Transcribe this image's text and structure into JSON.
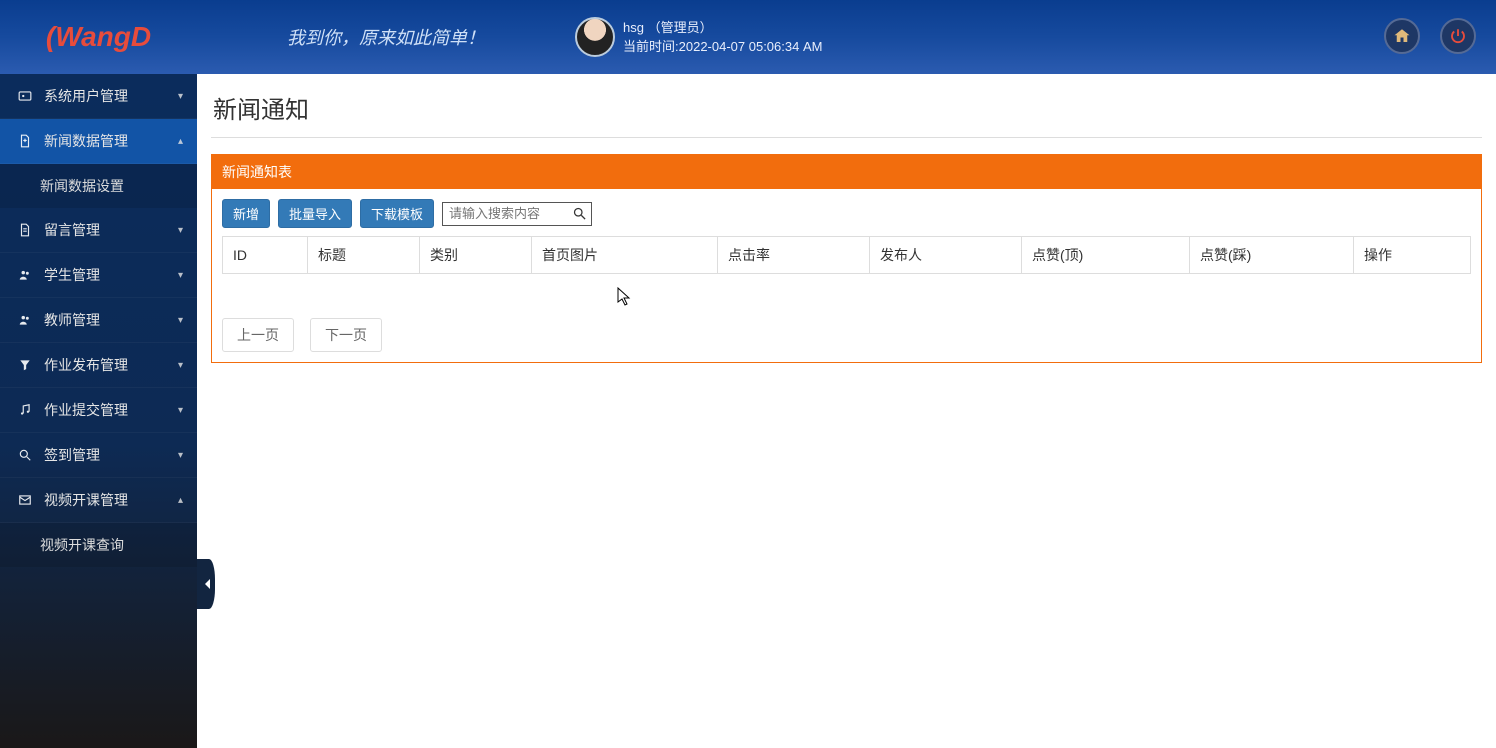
{
  "header": {
    "logo_red_arc": "(",
    "logo_text_1": "Wang",
    "logo_text_2": "D",
    "tagline": "我到你，原来如此简单！",
    "user_name": "hsg",
    "user_role": "（管理员）",
    "time_prefix": "当前时间:",
    "time_value": "2022-04-07 05:06:34 AM"
  },
  "sidebar": {
    "items": [
      {
        "label": "系统用户管理",
        "icon": "id-card-icon",
        "caret": "▾",
        "active": false
      },
      {
        "label": "新闻数据管理",
        "icon": "file-icon",
        "caret": "▴",
        "active": true,
        "children": [
          {
            "label": "新闻数据设置"
          }
        ]
      },
      {
        "label": "留言管理",
        "icon": "doc-icon",
        "caret": "▾",
        "active": false
      },
      {
        "label": "学生管理",
        "icon": "users-icon",
        "caret": "▾",
        "active": false
      },
      {
        "label": "教师管理",
        "icon": "users-icon",
        "caret": "▾",
        "active": false
      },
      {
        "label": "作业发布管理",
        "icon": "filter-icon",
        "caret": "▾",
        "active": false
      },
      {
        "label": "作业提交管理",
        "icon": "music-icon",
        "caret": "▾",
        "active": false
      },
      {
        "label": "签到管理",
        "icon": "search-icon",
        "caret": "▾",
        "active": false
      },
      {
        "label": "视频开课管理",
        "icon": "mail-icon",
        "caret": "▴",
        "active": false,
        "children": [
          {
            "label": "视频开课查询"
          }
        ]
      }
    ]
  },
  "page": {
    "title": "新闻通知",
    "panel_head": "新闻通知表",
    "buttons": {
      "add": "新增",
      "import": "批量导入",
      "template": "下载模板"
    },
    "search_placeholder": "请输入搜索内容",
    "columns": [
      "ID",
      "标题",
      "类别",
      "首页图片",
      "点击率",
      "发布人",
      "点赞(顶)",
      "点赞(踩)",
      "操作"
    ],
    "pager": {
      "prev": "上一页",
      "next": "下一页"
    }
  }
}
